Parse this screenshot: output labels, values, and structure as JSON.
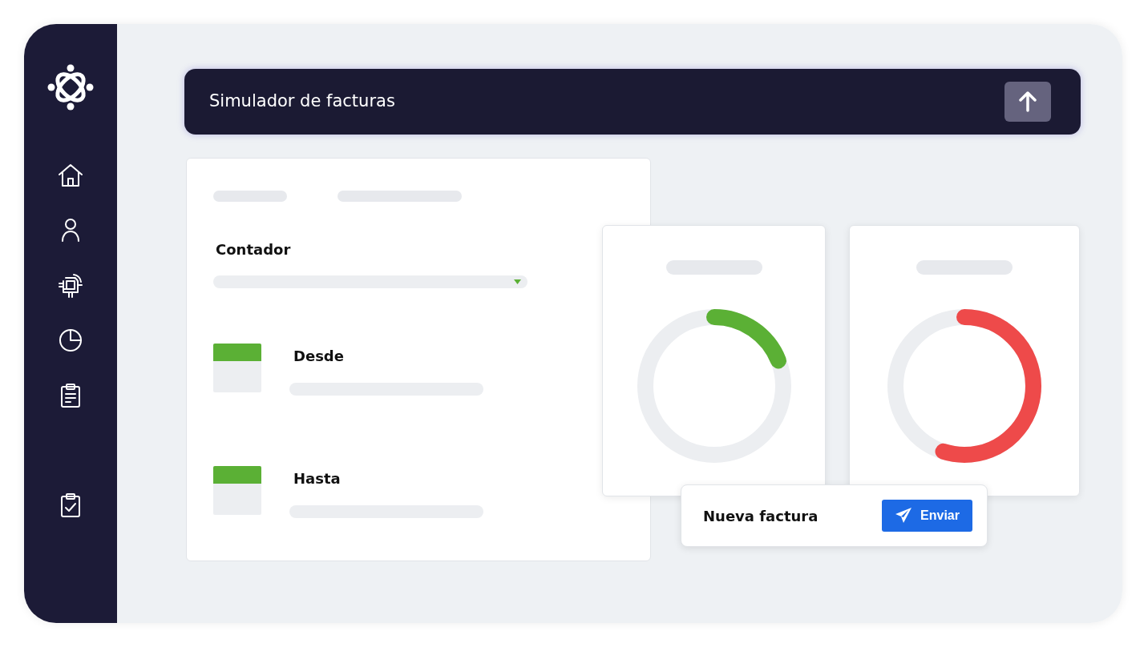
{
  "header": {
    "title": "Simulador de facturas"
  },
  "form": {
    "label": "Contador",
    "dates": [
      {
        "label": "Desde"
      },
      {
        "label": "Hasta"
      }
    ]
  },
  "gauges": [
    {
      "level": 0.19,
      "color": "#5bb035"
    },
    {
      "level": 0.55,
      "color": "#ee4a4a"
    }
  ],
  "popup": {
    "title": "Nueva factura",
    "button": "Enviar"
  }
}
